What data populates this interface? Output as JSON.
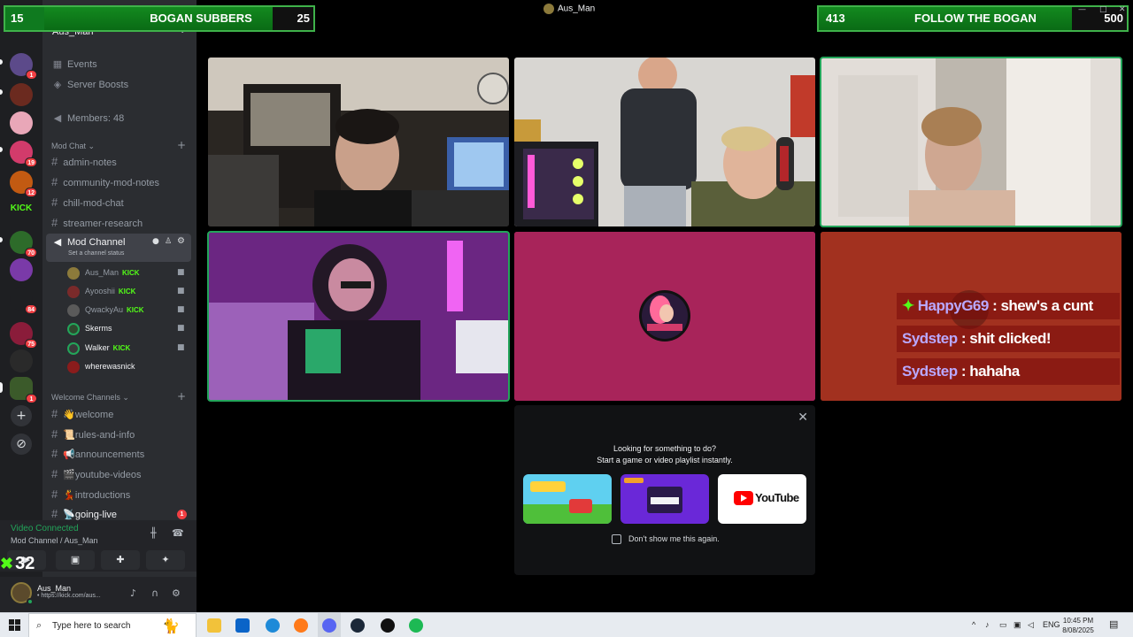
{
  "overlays": {
    "subs": {
      "current": "15",
      "title": "BOGAN SUBBERS",
      "goal": "25"
    },
    "follows": {
      "current": "413",
      "title": "FOLLOW THE BOGAN",
      "goal": "500"
    },
    "kick_viewers": "32"
  },
  "call": {
    "title": "Aus_Man"
  },
  "server": {
    "name": "Aus_Man",
    "badges": [
      "1",
      "19",
      "12",
      "70",
      "84",
      "75",
      "1"
    ],
    "kick_label": "KICK"
  },
  "channels": {
    "top_items": [
      {
        "label": "Events",
        "icon": "calendar-icon"
      },
      {
        "label": "Server Boosts",
        "icon": "boost-icon"
      },
      {
        "label": "Members: 48",
        "icon": "megaphone-icon"
      }
    ],
    "mod_chat_category": "Mod Chat",
    "mod_chat": [
      "admin-notes",
      "community-mod-notes",
      "chill-mod-chat",
      "streamer-research"
    ],
    "active_voice": {
      "label": "Mod Channel",
      "status": "Set a channel status"
    },
    "voice_users": [
      {
        "name": "Aus_Man",
        "kick": "KICK"
      },
      {
        "name": "Ayooshii",
        "kick": "KICK"
      },
      {
        "name": "QwackyAu",
        "kick": "KICK"
      },
      {
        "name": "Skerms",
        "kick": ""
      },
      {
        "name": "Walker",
        "kick": "KICK"
      },
      {
        "name": "wherewasnick",
        "kick": ""
      }
    ],
    "welcome_category": "Welcome Channels",
    "welcome": [
      "👋welcome",
      "📜rules-and-info",
      "📢announcements",
      "🎬youtube-videos",
      "💃introductions",
      "📡going-live"
    ],
    "going_live_badge": "1"
  },
  "voice_panel": {
    "title": "Video Connected",
    "sub": "Mod Channel / Aus_Man"
  },
  "user": {
    "name": "Aus_Man",
    "status": "• https://kick.com/aus..."
  },
  "chat": [
    {
      "name": "HappyG69",
      "msg": " : shew's a cunt"
    },
    {
      "name": "Sydstep",
      "msg": " : shit clicked!"
    },
    {
      "name": "Sydstep",
      "msg": " : hahaha"
    }
  ],
  "activity": {
    "line1": "Looking for something to do?",
    "line2": "Start a game or video playlist instantly.",
    "youtube": "YouTube",
    "checkbox": "Don't show me this again."
  },
  "taskbar": {
    "search_placeholder": "Type here to search",
    "lang": "ENG",
    "time": "10:45 PM",
    "date": "8/08/2025"
  },
  "colors": {
    "discord_bg": "#2b2d31",
    "rail_bg": "#1e1f22",
    "kick_green": "#53fc18",
    "overlay_green": "#13891f",
    "speaking": "#23a55a"
  }
}
